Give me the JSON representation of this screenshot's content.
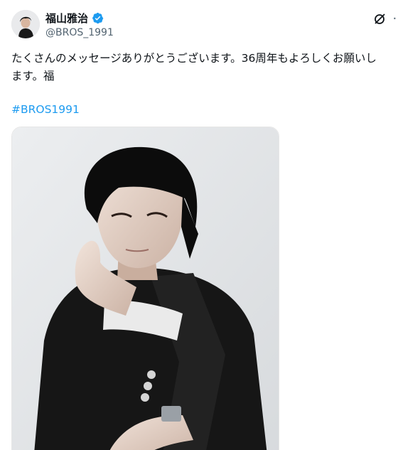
{
  "author": {
    "display_name": "福山雅治",
    "handle": "@BROS_1991",
    "verified": true,
    "avatar_icon": "profile-avatar"
  },
  "actions": {
    "grok_icon": "grok-icon",
    "more_icon": "more-horizontal-icon"
  },
  "tweet": {
    "text_line1": "たくさんのメッセージありがとうございます。36周年もよろしくお願いし",
    "text_line2": "ます。福",
    "hashtag": "#BROS1991"
  },
  "media": {
    "description_icon": "attached-photo"
  },
  "colors": {
    "link": "#1d9bf0",
    "verified": "#1d9bf0",
    "secondary_text": "#536471"
  }
}
